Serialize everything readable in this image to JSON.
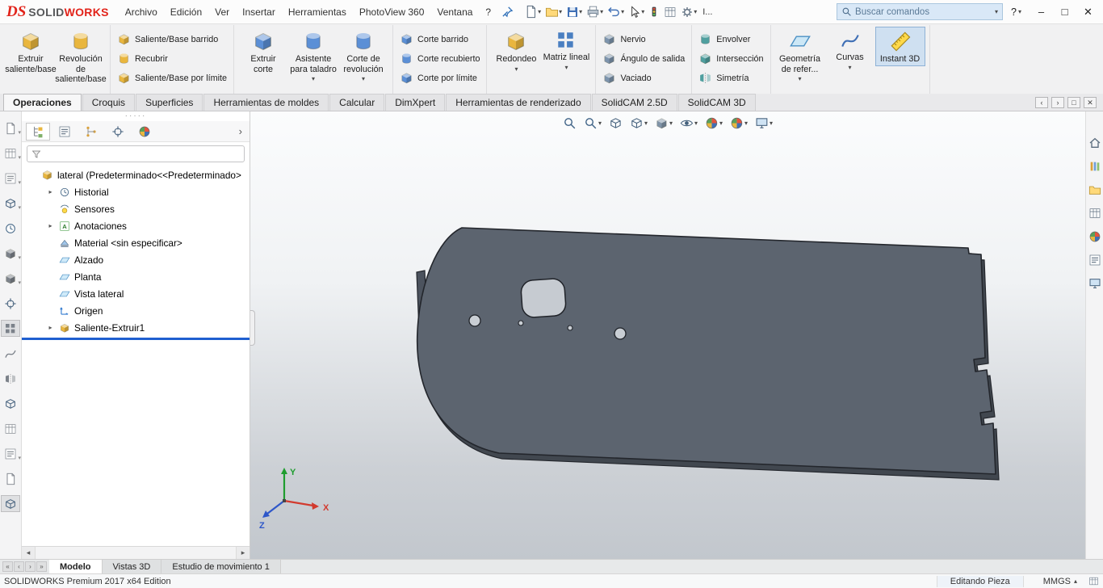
{
  "icons": {
    "chevron_down": "▾",
    "expander": "▸",
    "collapse": "›",
    "scroll_left": "◂",
    "scroll_right": "▸",
    "nav_first": "«",
    "nav_prev": "‹",
    "nav_next": "›",
    "nav_last": "»",
    "minimize": "–",
    "maximize": "□",
    "close": "✕",
    "caret_up": "▴",
    "grip_dots": "·····"
  },
  "titlebar": {
    "logo": {
      "ds": "DS",
      "solid": "SOLID",
      "works": "WORKS"
    },
    "menus": [
      "Archivo",
      "Edición",
      "Ver",
      "Insertar",
      "Herramientas",
      "PhotoView 360",
      "Ventana",
      "?"
    ],
    "overflow": "I...",
    "help": "?",
    "search": {
      "placeholder": "Buscar comandos",
      "value": ""
    }
  },
  "ribbon": {
    "tabs": [
      "Operaciones",
      "Croquis",
      "Superficies",
      "Herramientas de moldes",
      "Calcular",
      "DimXpert",
      "Herramientas de renderizado",
      "SolidCAM 2.5D",
      "SolidCAM 3D"
    ],
    "active_tab": "Operaciones",
    "groups": [
      {
        "items": [
          {
            "label": "Extruir saliente/base"
          },
          {
            "label": "Revolución de saliente/base"
          }
        ]
      },
      {
        "items": [
          {
            "label": "Saliente/Base barrido"
          },
          {
            "label": "Recubrir"
          },
          {
            "label": "Saliente/Base por límite"
          }
        ]
      },
      {
        "items": [
          {
            "label": "Extruir corte"
          },
          {
            "label": "Asistente para taladro"
          },
          {
            "label": "Corte de revolución"
          }
        ]
      },
      {
        "items": [
          {
            "label": "Corte barrido"
          },
          {
            "label": "Corte recubierto"
          },
          {
            "label": "Corte por límite"
          }
        ]
      },
      {
        "items": [
          {
            "label": "Redondeo"
          },
          {
            "label": "Matriz lineal"
          }
        ]
      },
      {
        "items": [
          {
            "label": "Nervio"
          },
          {
            "label": "Ángulo de salida"
          },
          {
            "label": "Vaciado"
          }
        ]
      },
      {
        "items": [
          {
            "label": "Envolver"
          },
          {
            "label": "Intersección"
          },
          {
            "label": "Simetría"
          }
        ]
      },
      {
        "items": [
          {
            "label": "Geometría de refer..."
          },
          {
            "label": "Curvas"
          },
          {
            "label": "Instant 3D"
          }
        ]
      }
    ]
  },
  "feature_tree": {
    "root": "lateral (Predeterminado<<Predeterminado>",
    "items": [
      "Historial",
      "Sensores",
      "Anotaciones",
      "Material <sin especificar>",
      "Alzado",
      "Planta",
      "Vista lateral",
      "Origen",
      "Saliente-Extruir1"
    ]
  },
  "viewport": {
    "triad": {
      "x": "X",
      "y": "Y",
      "z": "Z"
    }
  },
  "bottom_tabs": [
    "Modelo",
    "Vistas 3D",
    "Estudio de movimiento 1"
  ],
  "statusbar": {
    "product": "SOLIDWORKS Premium 2017 x64 Edition",
    "mode": "Editando Pieza",
    "units": "MMGS"
  },
  "colors": {
    "accent_blue": "#1f5fd0",
    "brand_red": "#e2231a",
    "part_gray": "#5c646f"
  }
}
